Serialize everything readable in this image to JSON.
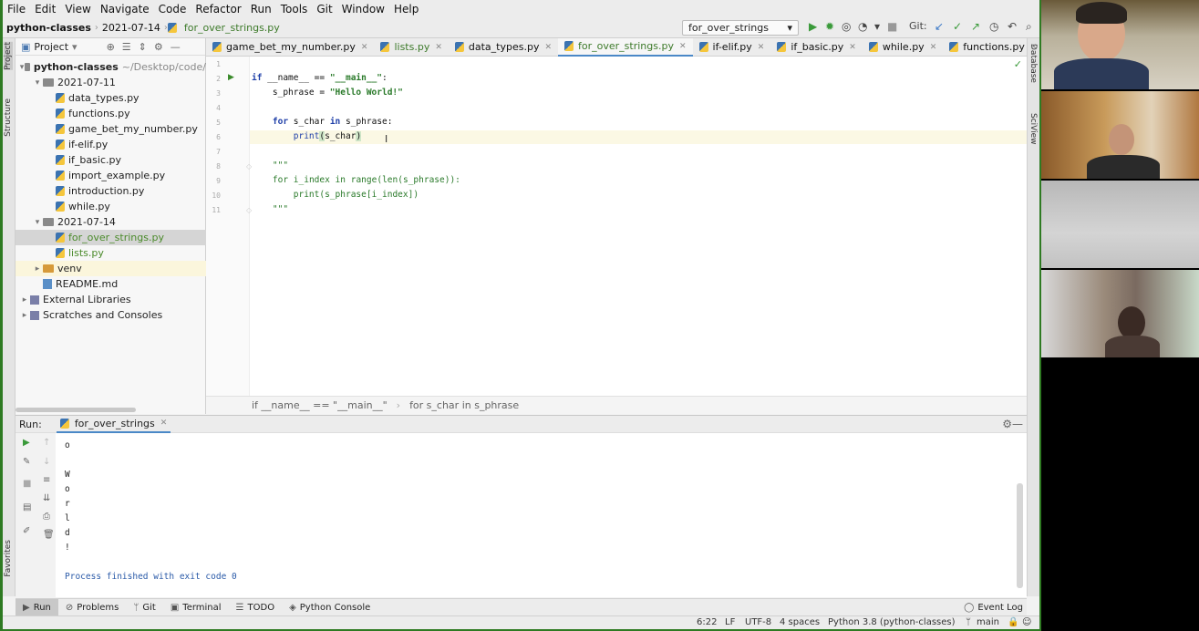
{
  "menu": [
    "File",
    "Edit",
    "View",
    "Navigate",
    "Code",
    "Refactor",
    "Run",
    "Tools",
    "Git",
    "Window",
    "Help"
  ],
  "nav": {
    "project": "python-classes",
    "folder": "2021-07-14",
    "file": "for_over_strings.py"
  },
  "toolbar": {
    "run_config": "for_over_strings",
    "git_label": "Git:"
  },
  "project_panel": {
    "title": "Project",
    "tree": [
      {
        "label": "python-classes",
        "note": "~/Desktop/code/",
        "level": 0,
        "kind": "folder",
        "arrow": "▾"
      },
      {
        "label": "2021-07-11",
        "level": 1,
        "kind": "folder",
        "arrow": "▾"
      },
      {
        "label": "data_types.py",
        "level": 2,
        "kind": "py"
      },
      {
        "label": "functions.py",
        "level": 2,
        "kind": "py"
      },
      {
        "label": "game_bet_my_number.py",
        "level": 2,
        "kind": "py"
      },
      {
        "label": "if-elif.py",
        "level": 2,
        "kind": "py"
      },
      {
        "label": "if_basic.py",
        "level": 2,
        "kind": "py"
      },
      {
        "label": "import_example.py",
        "level": 2,
        "kind": "py"
      },
      {
        "label": "introduction.py",
        "level": 2,
        "kind": "py"
      },
      {
        "label": "while.py",
        "level": 2,
        "kind": "py"
      },
      {
        "label": "2021-07-14",
        "level": 1,
        "kind": "folder",
        "arrow": "▾"
      },
      {
        "label": "for_over_strings.py",
        "level": 2,
        "kind": "py",
        "selected": true,
        "green": true
      },
      {
        "label": "lists.py",
        "level": 2,
        "kind": "py",
        "green": true
      },
      {
        "label": "venv",
        "level": 1,
        "kind": "venv",
        "arrow": "▸"
      },
      {
        "label": "README.md",
        "level": 1,
        "kind": "md"
      },
      {
        "label": "External Libraries",
        "level": 0,
        "kind": "lib",
        "arrow": "▸"
      },
      {
        "label": "Scratches and Consoles",
        "level": 0,
        "kind": "lib",
        "arrow": "▸"
      }
    ]
  },
  "tabs": [
    {
      "label": "game_bet_my_number.py",
      "active": false
    },
    {
      "label": "lists.py",
      "active": false,
      "green": true
    },
    {
      "label": "data_types.py",
      "active": false
    },
    {
      "label": "for_over_strings.py",
      "active": true,
      "green": true
    },
    {
      "label": "if-elif.py",
      "active": false
    },
    {
      "label": "if_basic.py",
      "active": false
    },
    {
      "label": "while.py",
      "active": false
    },
    {
      "label": "functions.py",
      "active": false
    }
  ],
  "editor": {
    "line_numbers": [
      "1",
      "2",
      "3",
      "4",
      "5",
      "6",
      "7",
      "8",
      "9",
      "10",
      "11"
    ],
    "l2": {
      "kw": "if",
      "rest": " __name__ == ",
      "str": "\"__main__\"",
      "end": ":"
    },
    "l3": {
      "pre": "    s_phrase = ",
      "str": "\"Hello World!\""
    },
    "l5": {
      "pre": "    ",
      "kw1": "for",
      "mid": " s_char ",
      "kw2": "in",
      "end": " s_phrase:"
    },
    "l6": {
      "pre": "        ",
      "fn": "print",
      "open": "(",
      "arg": "s_char",
      "close": ")"
    },
    "l8": "    \"\"\"",
    "l9": {
      "pre": "    ",
      "kw1": "for",
      "mid": " i_index ",
      "kw2": "in",
      "sp": " ",
      "fn1": "range",
      "p1": "(",
      "fn2": "len",
      "rest": "(s_phrase)):"
    },
    "l10": {
      "pre": "        ",
      "fn": "print",
      "rest": "(s_phrase[i_index])"
    },
    "l11": "    \"\"\"",
    "breadcrumb": [
      "if __name__ == \"__main__\"",
      "for s_char in s_phrase"
    ]
  },
  "run": {
    "label": "Run:",
    "tab": "for_over_strings",
    "output": [
      "o",
      "",
      "W",
      "o",
      "r",
      "l",
      "d",
      "!",
      "",
      "Process finished with exit code 0"
    ]
  },
  "bottom_tabs": [
    {
      "label": "Run",
      "icon": "▶",
      "active": true
    },
    {
      "label": "Problems",
      "icon": "⊘"
    },
    {
      "label": "Git",
      "icon": "ᛘ"
    },
    {
      "label": "Terminal",
      "icon": "▣"
    },
    {
      "label": "TODO",
      "icon": "☰"
    },
    {
      "label": "Python Console",
      "icon": "◈"
    }
  ],
  "event_log": "Event Log",
  "status": {
    "pos": "6:22",
    "lf": "LF",
    "enc": "UTF-8",
    "indent": "4 spaces",
    "interp": "Python 3.8 (python-classes)",
    "branch": "main"
  },
  "side_labels": {
    "left": [
      "Project",
      "Structure",
      "Favorites"
    ],
    "right": [
      "Database",
      "SciView"
    ]
  }
}
